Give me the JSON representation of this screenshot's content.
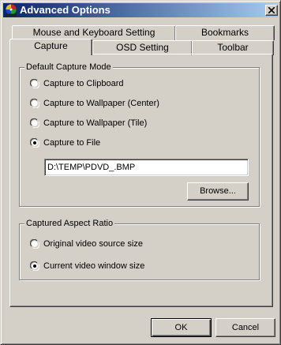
{
  "window": {
    "title": "Advanced Options",
    "title_icon": "dvd-app-icon",
    "close_icon": "close-icon"
  },
  "tabs": {
    "row_back": [
      {
        "label": "Mouse and Keyboard Setting"
      },
      {
        "label": "Bookmarks"
      }
    ],
    "row_front": [
      {
        "label": "Capture",
        "active": true
      },
      {
        "label": "OSD Setting"
      },
      {
        "label": "Toolbar"
      }
    ]
  },
  "capture_mode": {
    "legend": "Default Capture Mode",
    "options": [
      {
        "label": "Capture to Clipboard",
        "selected": false
      },
      {
        "label": "Capture to Wallpaper (Center)",
        "selected": false
      },
      {
        "label": "Capture to Wallpaper (Tile)",
        "selected": false
      },
      {
        "label": "Capture to File",
        "selected": true
      }
    ],
    "file_path": "D:\\TEMP\\PDVD_.BMP",
    "browse_label": "Browse..."
  },
  "aspect_ratio": {
    "legend": "Captured Aspect Ratio",
    "options": [
      {
        "label": "Original video source size",
        "selected": false
      },
      {
        "label": "Current video window size",
        "selected": true
      }
    ]
  },
  "footer": {
    "ok_label": "OK",
    "cancel_label": "Cancel"
  }
}
